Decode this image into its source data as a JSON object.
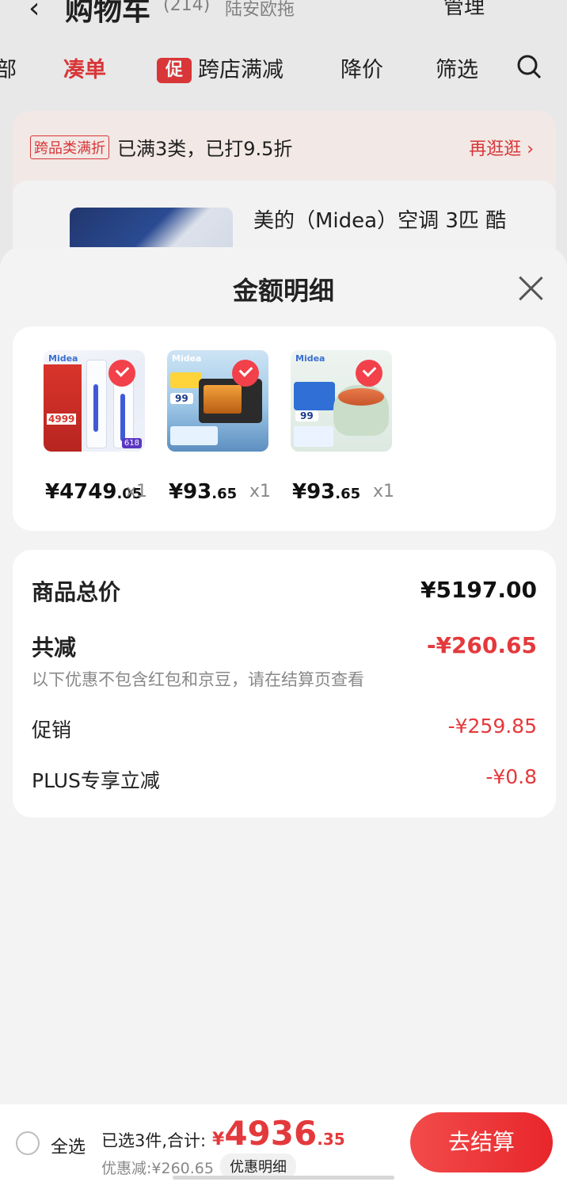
{
  "background": {
    "back_icon": "chevron-left-icon",
    "title": "购物车",
    "count": "(214)",
    "location": "陆安欧拖",
    "manage": "管理",
    "tabs": [
      {
        "label": "部",
        "active": false
      },
      {
        "label": "凑单",
        "active": true
      },
      {
        "label": "跨店满减",
        "active": false,
        "badge": "促"
      },
      {
        "label": "降价",
        "active": false
      },
      {
        "label": "筛选",
        "active": false
      }
    ],
    "search_icon": "search-icon",
    "strip_badge": "跨品类满折",
    "strip_text": "已满3类，已打9.5折",
    "strip_more": "再逛逛",
    "item_title": "美的（Midea）空调 3匹 酷"
  },
  "sheet": {
    "title": "金额明细",
    "close_icon": "close-icon",
    "products": [
      {
        "name": "midea-air-conditioner",
        "price_int": "¥4749",
        "price_dec": ".05",
        "qty": "x1",
        "checked": true
      },
      {
        "name": "midea-oven",
        "price_int": "¥93",
        "price_dec": ".65",
        "qty": "x1",
        "checked": true
      },
      {
        "name": "midea-electric-pot",
        "price_int": "¥93",
        "price_dec": ".65",
        "qty": "x1",
        "checked": true
      }
    ],
    "summary": {
      "total_label": "商品总价",
      "total_value": "¥5197.00",
      "reduce_label": "共减",
      "reduce_value": "-¥260.65",
      "reduce_note": "以下优惠不包含红包和京豆，请在结算页查看",
      "promo_label": "促销",
      "promo_value": "-¥259.85",
      "plus_label": "PLUS专享立减",
      "plus_value": "-¥0.8"
    }
  },
  "bottom_bar": {
    "select_all": "全选",
    "selected_info": "已选3件,合计:",
    "total_symbol": "¥",
    "total_int": "4936",
    "total_dec": ".35",
    "discount": "优惠减:¥260.65",
    "detail_button": "优惠明细",
    "checkout_button": "去结算"
  },
  "colors": {
    "accent": "#e4393c",
    "sheet_bg": "#f3f3f3",
    "card_bg": "#ffffff"
  }
}
